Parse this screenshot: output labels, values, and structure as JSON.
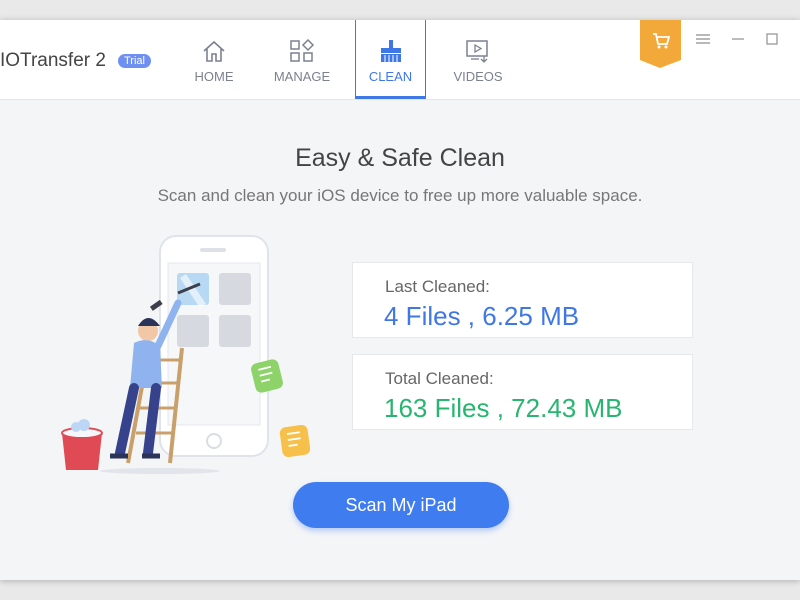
{
  "app": {
    "name": "IOTransfer 2",
    "badge": "Trial"
  },
  "nav": {
    "tabs": [
      {
        "label": "HOME",
        "icon": "home-icon"
      },
      {
        "label": "MANAGE",
        "icon": "grid-icon"
      },
      {
        "label": "CLEAN",
        "icon": "broom-icon",
        "active": true
      },
      {
        "label": "VIDEOS",
        "icon": "video-icon"
      }
    ]
  },
  "window_controls": [
    "cart-icon",
    "menu-icon",
    "minimize-icon",
    "maximize-icon"
  ],
  "main": {
    "title": "Easy & Safe Clean",
    "subtitle": "Scan and clean your iOS device to free up more valuable space."
  },
  "stats": {
    "last": {
      "label": "Last Cleaned:",
      "value": "4 Files , 6.25 MB"
    },
    "total": {
      "label": "Total Cleaned:",
      "value": "163 Files , 72.43 MB"
    }
  },
  "action": {
    "scan_label": "Scan My iPad"
  },
  "colors": {
    "accent": "#3e7cf0",
    "last_value": "#3f78e6",
    "total_value": "#27b56f",
    "cart": "#f3a93a",
    "trial_badge": "#6f8ff2"
  }
}
